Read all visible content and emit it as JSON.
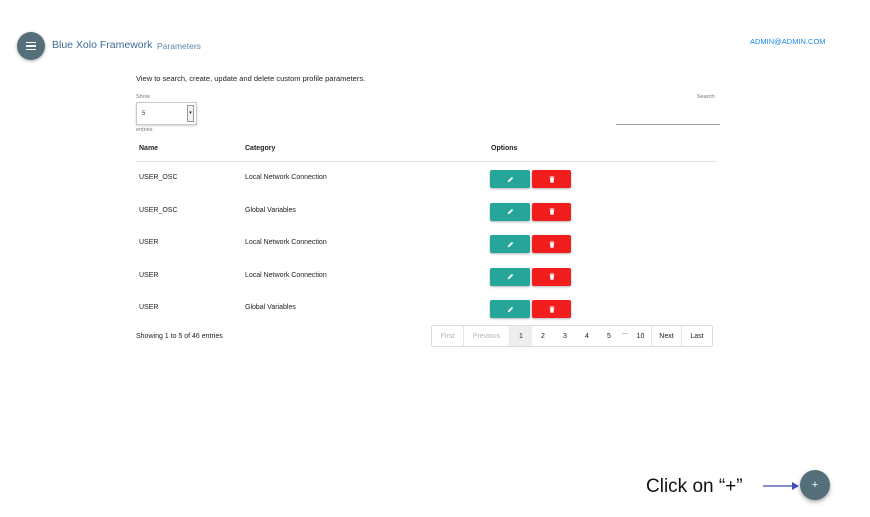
{
  "header": {
    "brand": "Blue Xolo Framework",
    "breadcrumb": "Parameters",
    "user": "ADMIN@ADMIN.COM",
    "menu_icon": "hamburger-menu-icon"
  },
  "main": {
    "intro": "View to search, create, update and delete custom profile parameters.",
    "length": {
      "show_label": "Show",
      "value": "5",
      "entries_label": "entries"
    },
    "search": {
      "label": "Search:",
      "value": ""
    }
  },
  "table": {
    "columns": [
      "Name",
      "Category",
      "Options"
    ],
    "rows": [
      {
        "name": "USER_OSC",
        "category": "Local Network Connection"
      },
      {
        "name": "USER_OSC",
        "category": "Global Variables"
      },
      {
        "name": "USER",
        "category": "Local Network Connection"
      },
      {
        "name": "USER",
        "category": "Local Network Connection"
      },
      {
        "name": "USER",
        "category": "Global Variables"
      }
    ],
    "edit_icon": "pencil-icon",
    "delete_icon": "trash-icon",
    "colors": {
      "edit": "#26a69a",
      "delete": "#f21d1d"
    }
  },
  "footer": {
    "info": "Showing 1 to 5 of 46 entries",
    "pagination": {
      "first": "First",
      "previous": "Previous",
      "pages": [
        "1",
        "2",
        "3",
        "4",
        "5"
      ],
      "ellipsis": "...",
      "last_page": "10",
      "next": "Next",
      "last": "Last",
      "active": "1"
    }
  },
  "annotation": {
    "text": "Click on “+”"
  },
  "fab": {
    "label": "+"
  },
  "colors": {
    "brand_blue": "#3d6b92",
    "user_link": "#1e88e5",
    "fab": "#546e7a"
  }
}
